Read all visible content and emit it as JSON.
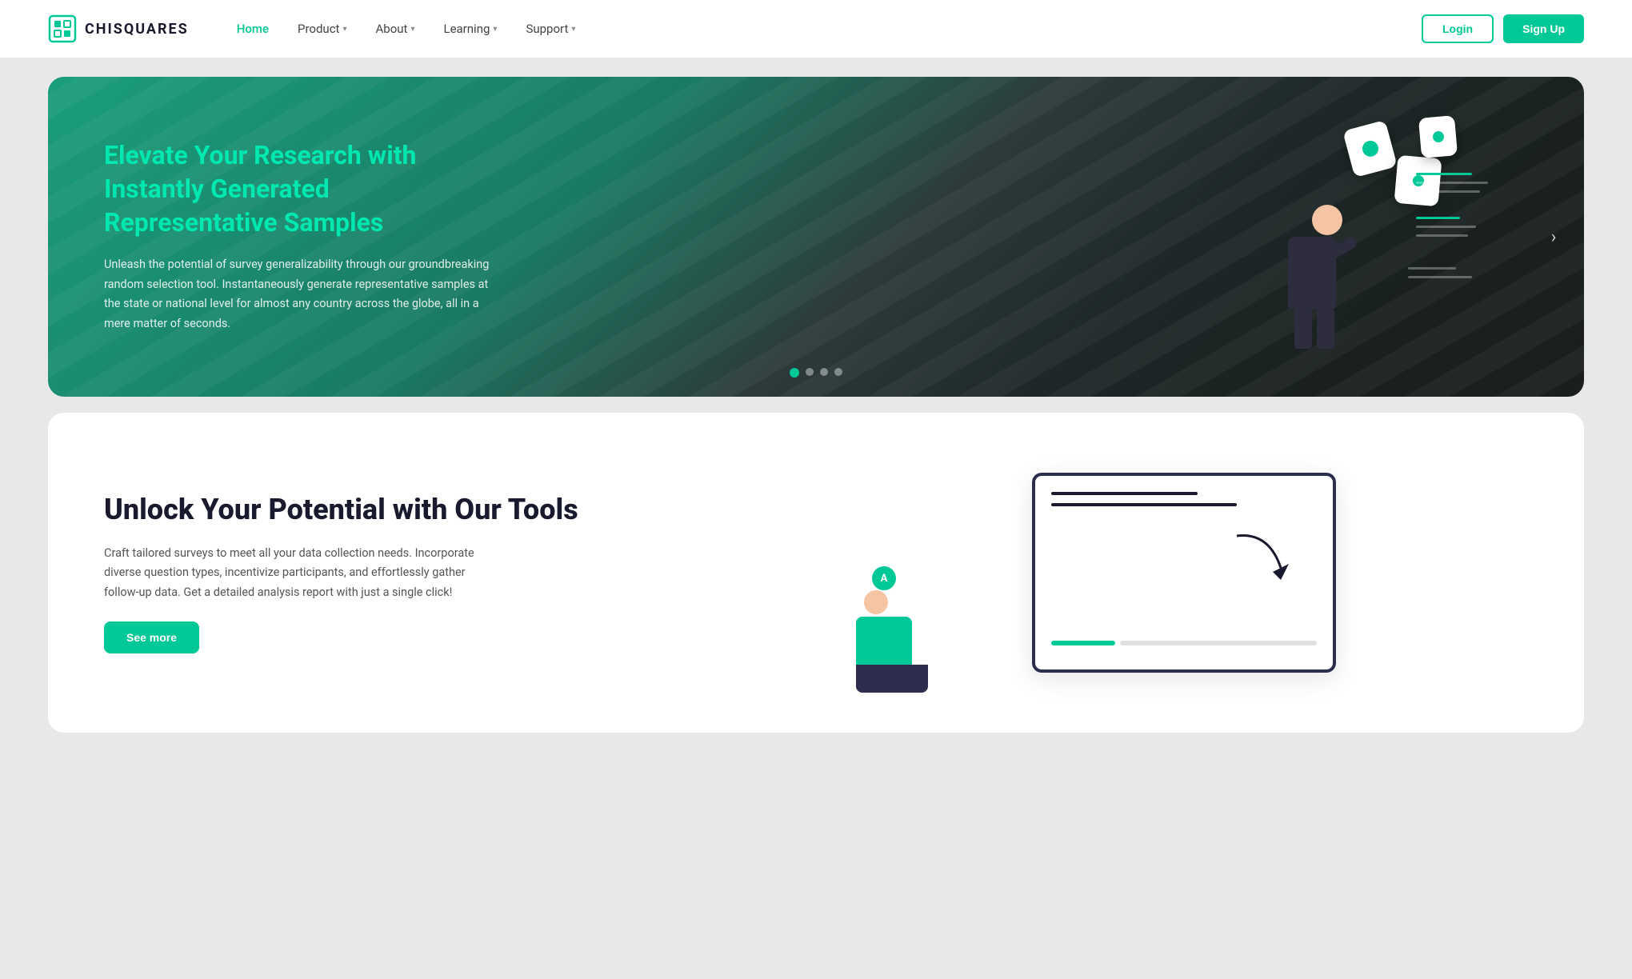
{
  "brand": {
    "name": "CHISQUARES",
    "logo_alt": "Chisquares logo"
  },
  "nav": {
    "home_label": "Home",
    "product_label": "Product",
    "about_label": "About",
    "learning_label": "Learning",
    "support_label": "Support",
    "login_label": "Login",
    "signup_label": "Sign Up"
  },
  "hero": {
    "title": "Elevate Your Research with Instantly Generated Representative Samples",
    "description": "Unleash the potential of survey generalizability through our groundbreaking random selection tool. Instantaneously generate representative samples at the state or national level for almost any country across the globe, all in a mere matter of seconds.",
    "arrow_label": "›",
    "dots": [
      {
        "active": true
      },
      {
        "active": false
      },
      {
        "active": false
      },
      {
        "active": false
      }
    ]
  },
  "section2": {
    "title": "Unlock Your Potential with Our Tools",
    "description": "Craft tailored surveys to meet all your data collection needs. Incorporate diverse question types, incentivize participants, and effortlessly gather follow-up data. Get a detailed analysis report with just a single click!",
    "cta_label": "See more"
  }
}
